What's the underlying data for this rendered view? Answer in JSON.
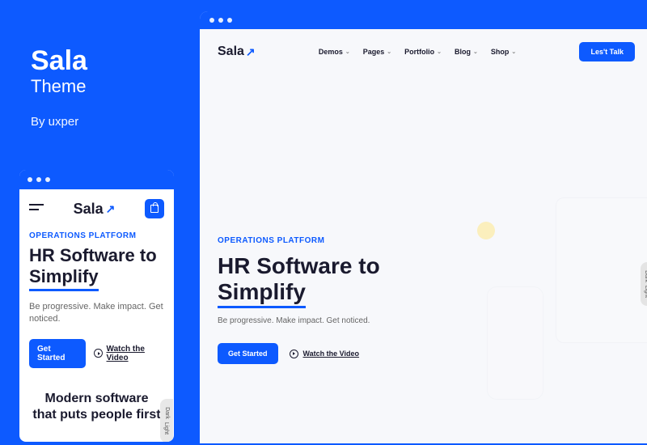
{
  "sidebar": {
    "title": "Sala",
    "subtitle": "Theme",
    "byline": "By uxper"
  },
  "logo": "Sala",
  "nav": {
    "items": [
      "Demos",
      "Pages",
      "Portfolio",
      "Blog",
      "Shop"
    ],
    "cta": "Les't Talk"
  },
  "hero": {
    "eyebrow": "OPERATIONS PLATFORM",
    "heading_pre": "HR Software to ",
    "heading_underlined": "Simplify",
    "tagline": "Be progressive. Make impact. Get noticed.",
    "primary_cta": "Get Started",
    "video_cta": "Watch the Video"
  },
  "mobile": {
    "modern": "Modern software that puts people first"
  },
  "toggle": {
    "dark": "Dark",
    "light": "Light"
  }
}
